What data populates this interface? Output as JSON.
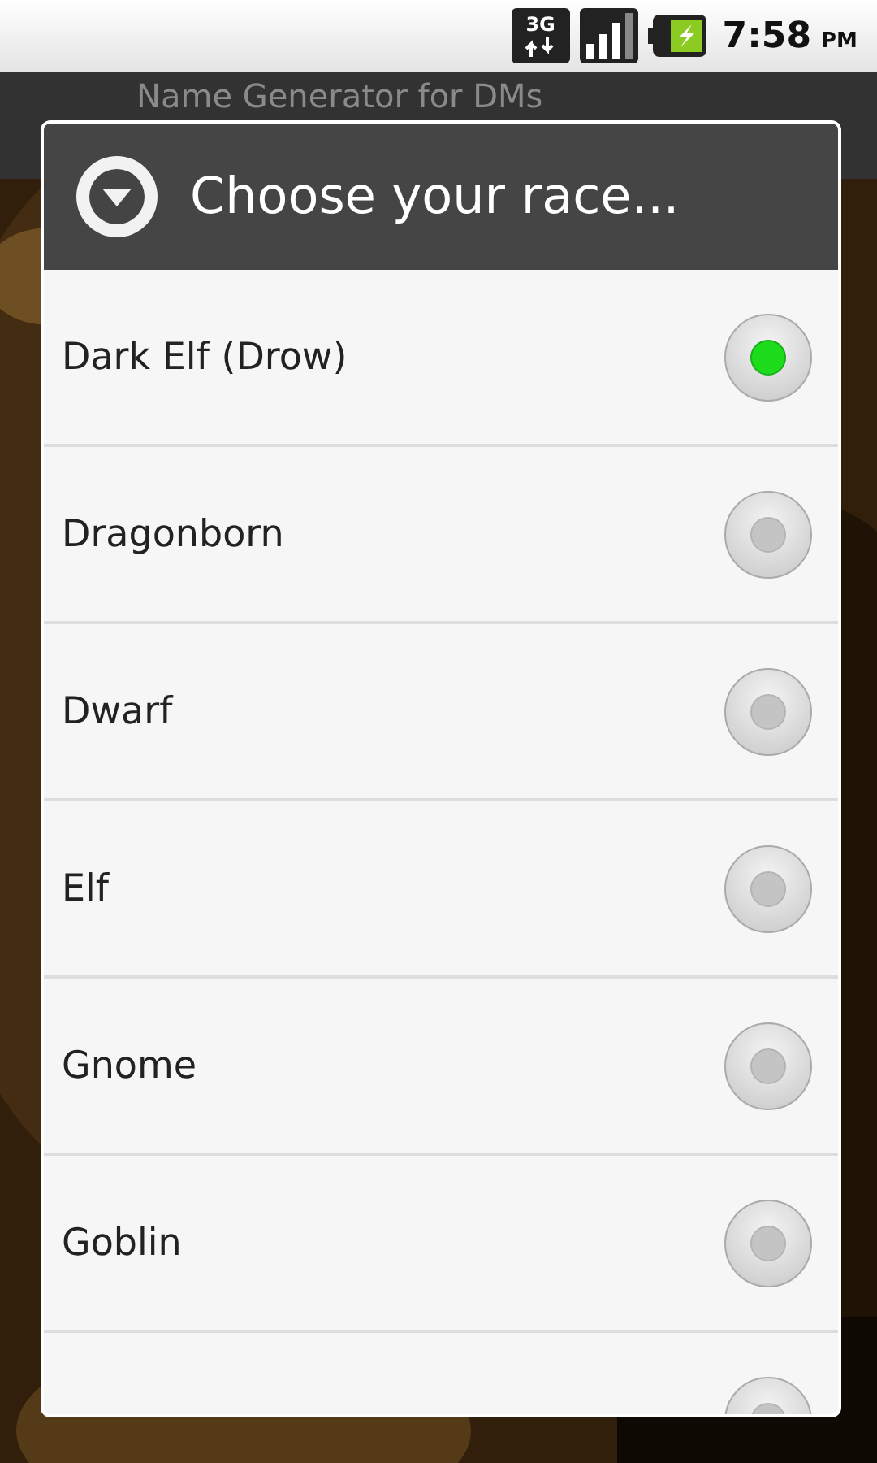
{
  "status_bar": {
    "time": "7:58",
    "meridiem": "PM",
    "network": "3G"
  },
  "app": {
    "title": "Name Generator for DMs"
  },
  "dialog": {
    "title": "Choose your race...",
    "options": [
      {
        "label": "Dark Elf (Drow)",
        "selected": true
      },
      {
        "label": "Dragonborn",
        "selected": false
      },
      {
        "label": "Dwarf",
        "selected": false
      },
      {
        "label": "Elf",
        "selected": false
      },
      {
        "label": "Gnome",
        "selected": false
      },
      {
        "label": "Goblin",
        "selected": false
      },
      {
        "selected": false
      }
    ]
  }
}
